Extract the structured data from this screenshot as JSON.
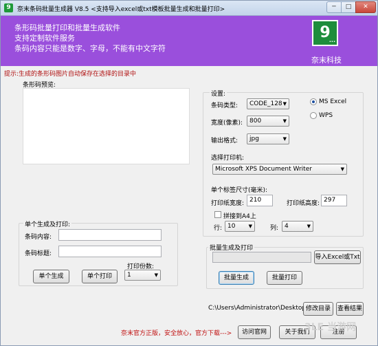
{
  "window": {
    "app_icon_text": "9",
    "title": "奈末条码批量生成器 V8.5  <支持导入excel或txt模板批量生成和批量打印>",
    "min_glyph": "─",
    "max_glyph": "□",
    "close_glyph": "✕"
  },
  "banner": {
    "lines": [
      "条形码批量打印和批量生成软件",
      "支持定制软件服务",
      "条码内容只能是数字、字母，不能有中文字符"
    ],
    "logo_text": "9",
    "logo_dots": "...",
    "company": "奈末科技",
    "bg_color": "#9a4fdc"
  },
  "hint": "提示:生成的条形码图片自动保存在选择的目录中",
  "preview_label": "条形码预览:",
  "single": {
    "group_label": "单个生成及打印:",
    "content_label": "条码内容:",
    "title_label": "条码标题:",
    "copies_label": "打印份数:",
    "copies_value": "1",
    "generate_button": "单个生成",
    "print_button": "单个打印"
  },
  "settings": {
    "group_label": "设置:",
    "type_label": "条码类型:",
    "type_value": "CODE_128",
    "width_label": "宽度(像素):",
    "width_value": "800",
    "format_label": "输出格式:",
    "format_value": "jpg",
    "radio_excel": "MS  Excel",
    "radio_wps": "WPS",
    "printer_label": "选择打印机:",
    "printer_value": "Microsoft XPS Document Writer",
    "label_size": "单个标签尺寸(毫米):",
    "paper_width_label": "打印纸宽度:",
    "paper_width_value": "210",
    "paper_height_label": "打印纸高度:",
    "paper_height_value": "297",
    "tile_a4_label": "拼接到A4上",
    "rows_label": "行:",
    "rows_value": "10",
    "cols_label": "列:",
    "cols_value": "4"
  },
  "batch": {
    "group_label": "批量生成及打印",
    "import_button": "导入Excel或Txt",
    "generate_button": "批量生成",
    "print_button": "批量打印"
  },
  "output": {
    "path": "C:\\Users\\Administrator\\Desktop",
    "change_dir_button": "修改目录",
    "view_button": "查看结果"
  },
  "footer": {
    "notice": "奈末官方正版，安全放心，官方下载--->",
    "visit_button": "访问官网",
    "about_button": "关于我们",
    "register_button": "注册"
  },
  "watermark": "3LE 当游网"
}
